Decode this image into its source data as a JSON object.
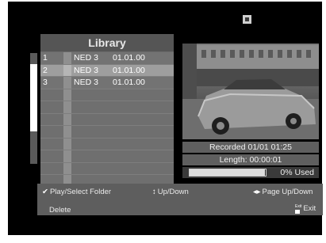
{
  "library": {
    "title": "Library",
    "rows": [
      {
        "num": "1",
        "title": "NED 3",
        "date": "01.01.00",
        "selected": false
      },
      {
        "num": "2",
        "title": "NED 3",
        "date": "01.01.00",
        "selected": true
      },
      {
        "num": "3",
        "title": "NED 3",
        "date": "01.01.00",
        "selected": false
      }
    ],
    "empty_row_count": 9,
    "scroll_position": 0.25
  },
  "info": {
    "recorded": "Recorded 01/01    01:25",
    "length": "Length: 00:00:01",
    "used_text": "0% Used",
    "used_fraction": 0.99
  },
  "help": {
    "play": "Play/Select Folder",
    "updown": "Up/Down",
    "page": "Page Up/Down",
    "delete": "Delete",
    "exit_key": "Exit",
    "exit": "Exit"
  },
  "icons": {
    "status": "stop-icon",
    "play": "check-icon",
    "updown": "up-down-arrows-icon",
    "page": "left-right-arrows-icon",
    "delete": "color-key-icon",
    "exit": "exit-key-icon"
  }
}
